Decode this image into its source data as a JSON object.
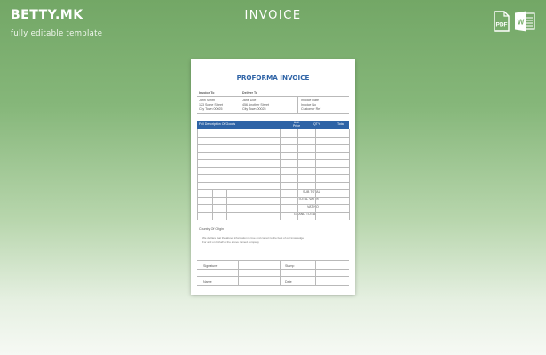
{
  "brand": {
    "name": "BETTY.MK",
    "tagline": "fully editable template"
  },
  "page_title": "INVOICE",
  "file_icons": [
    {
      "icon": "pdf-file-icon",
      "label": "PDF"
    },
    {
      "icon": "word-file-icon",
      "label": "W"
    }
  ],
  "colors": {
    "accent": "#2e63a6",
    "background_top": "#73a766",
    "background_bottom": "#f6f9f4"
  },
  "document": {
    "title": "PROFORMA INVOICE",
    "invoice_to": "Invoice To",
    "deliver_to": "Deliver To",
    "invoice_to_lines": [
      "John Smith",
      "123 Some Street",
      "City Town 00025"
    ],
    "deliver_to_lines": [
      "Jane Doe",
      "456 Another Street",
      "City Town 00025"
    ],
    "meta_lines": [
      "Invoice Date",
      "Invoice No",
      "Customer Ref"
    ],
    "columns": {
      "description": "Full Description Of Goods",
      "unit_price": "Unit Price",
      "qty": "QTY",
      "total": "Total"
    },
    "totals": {
      "sub_total": "SUB TOTAL",
      "total_vat": "TOTAL VAT %",
      "vat_no": "VAT NO",
      "grand_total": "GRAND TOTAL"
    },
    "country_of_origin": "Country Of Origin",
    "declaration_1": "We declare that the above information is true and correct to the best of our knowledge",
    "declaration_2": "For and on behalf of the above named company",
    "signature": "Signature",
    "stamp": "Stamp",
    "name": "Name",
    "date": "Date"
  }
}
